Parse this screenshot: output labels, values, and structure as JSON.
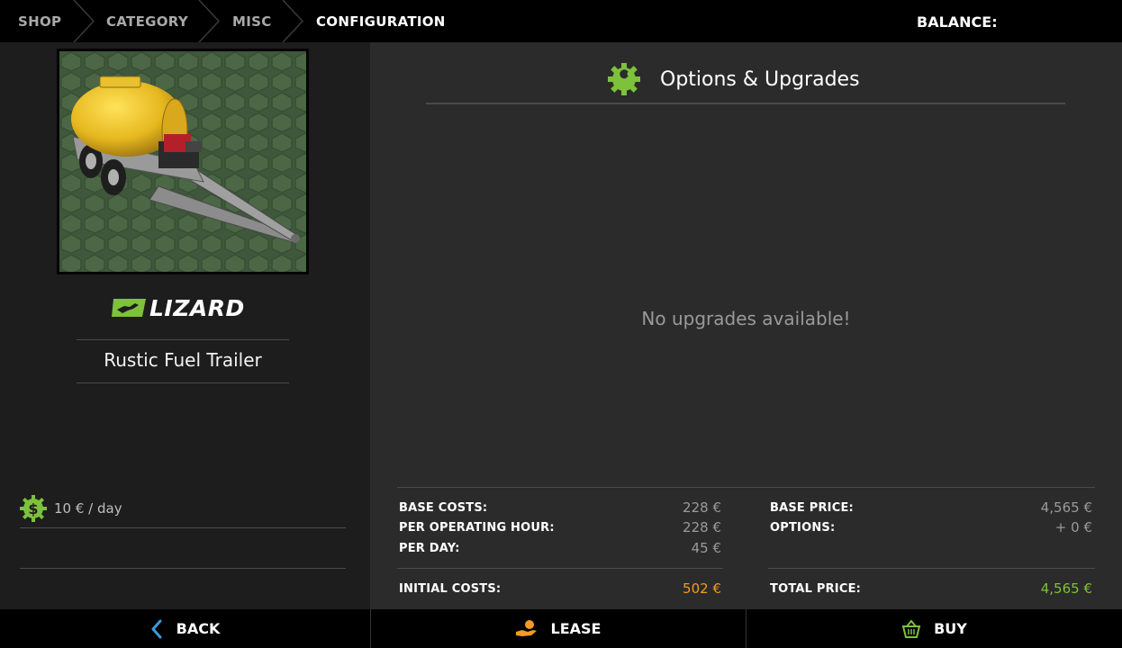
{
  "breadcrumb": {
    "items": [
      "SHOP",
      "CATEGORY",
      "MISC",
      "CONFIGURATION"
    ]
  },
  "balance": {
    "label": "BALANCE:"
  },
  "product": {
    "brand": "LIZARD",
    "name": "Rustic Fuel Trailer",
    "daily_rate": "10 € / day"
  },
  "options": {
    "title": "Options & Upgrades",
    "empty_text": "No upgrades available!"
  },
  "costs": {
    "base_costs": {
      "label": "BASE COSTS:",
      "value": "228 €"
    },
    "per_operating_hour": {
      "label": "PER OPERATING HOUR:",
      "value": "228 €"
    },
    "per_day": {
      "label": "PER DAY:",
      "value": "45 €"
    },
    "initial_costs": {
      "label": "INITIAL COSTS:",
      "value": "502 €"
    }
  },
  "price": {
    "base_price": {
      "label": "BASE PRICE:",
      "value": "4,565 €"
    },
    "options": {
      "label": "OPTIONS:",
      "value": "+ 0 €"
    },
    "total_price": {
      "label": "TOTAL PRICE:",
      "value": "4,565 €"
    }
  },
  "actions": {
    "back": "BACK",
    "lease": "LEASE",
    "buy": "BUY"
  },
  "colors": {
    "accent_green": "#7ec13a",
    "accent_orange": "#f59a23",
    "back_arrow_blue": "#3b9ad9"
  },
  "icons": {
    "options": "wrench-gear-icon",
    "rate": "dollar-gear-icon",
    "back": "chevron-left-icon",
    "lease": "hand-coin-icon",
    "buy": "basket-icon"
  }
}
